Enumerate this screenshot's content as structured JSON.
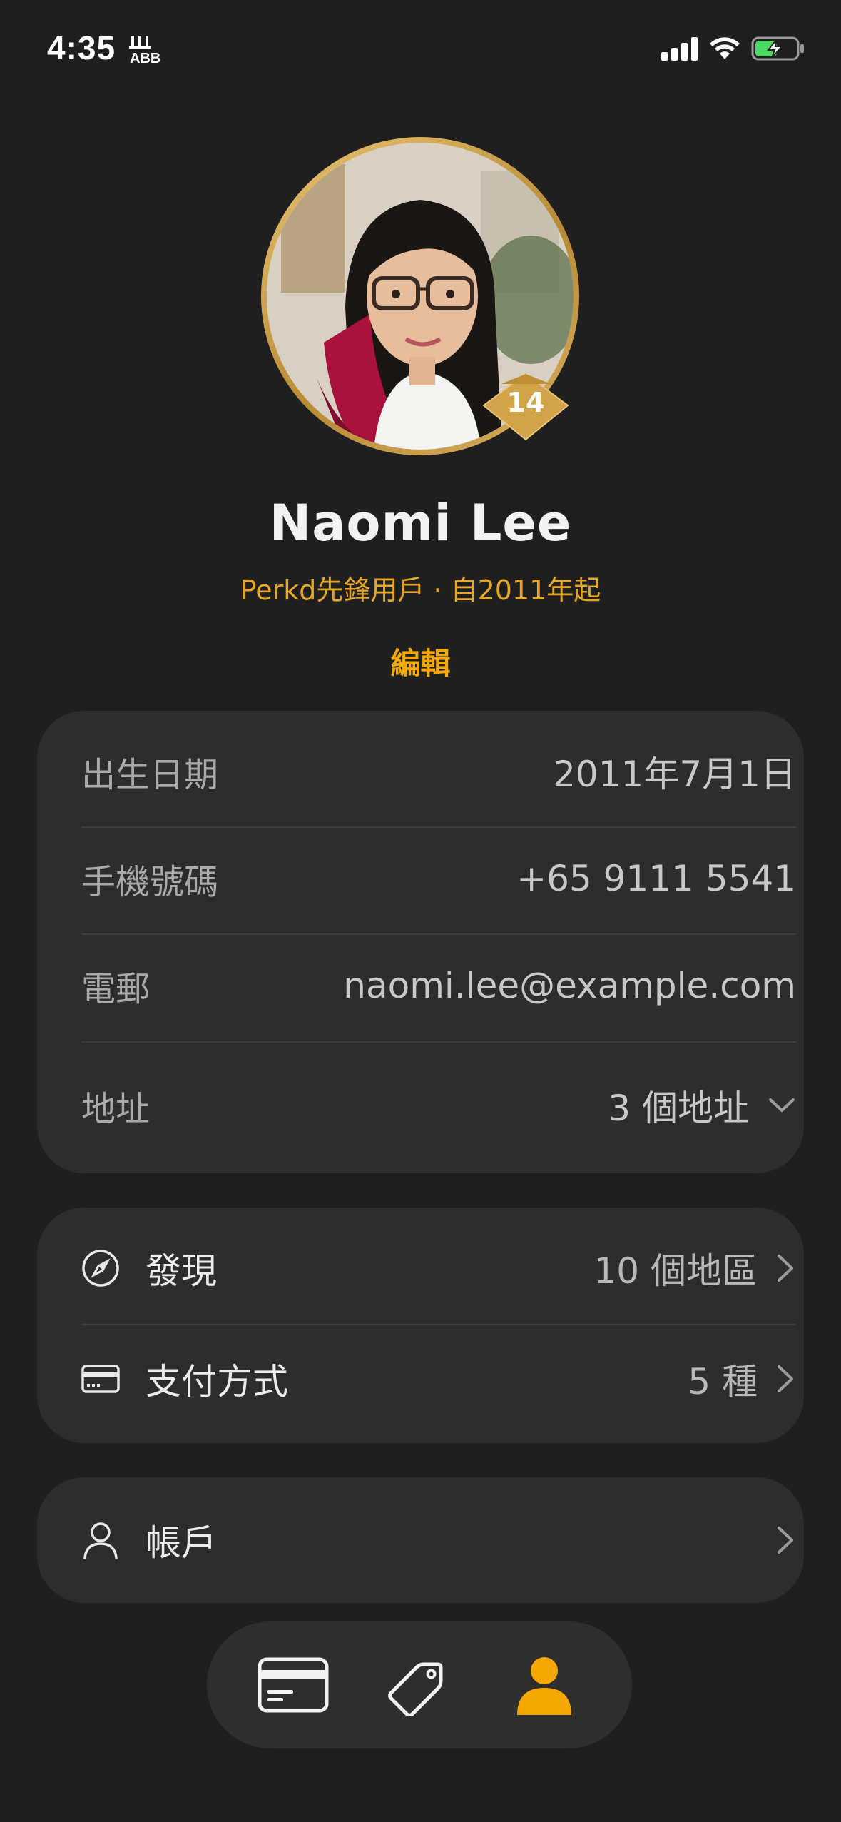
{
  "status_bar": {
    "time": "4:35",
    "app_icon": "abb-app-icon",
    "signal_icon": "cellular-signal-icon",
    "wifi_icon": "wifi-icon",
    "battery_icon": "battery-charging-icon"
  },
  "profile": {
    "level": "14",
    "name": "Naomi Lee",
    "subtitle": "Perkd先鋒用戶 · 自2011年起",
    "edit_label": "編輯"
  },
  "details": [
    {
      "label": "出生日期",
      "value": "2011年7月1日"
    },
    {
      "label": "手機號碼",
      "value": "+65 9111 5541"
    },
    {
      "label": "電郵",
      "value": "naomi.lee@example.com"
    },
    {
      "label": "地址",
      "value": "3 個地址",
      "icon": "chevron-down-icon"
    }
  ],
  "links": [
    {
      "label": "發現",
      "value": "10 個地區",
      "icon": "compass-icon"
    },
    {
      "label": "支付方式",
      "value": "5 種",
      "icon": "credit-card-icon"
    }
  ],
  "account": {
    "label": "帳戶",
    "icon": "person-icon"
  },
  "tab_bar": {
    "tabs": [
      {
        "icon": "card-icon",
        "active": false
      },
      {
        "icon": "tag-icon",
        "active": false
      },
      {
        "icon": "profile-icon",
        "active": true
      }
    ]
  },
  "colors": {
    "background": "#1f1f1f",
    "card": "#2d2d2d",
    "accent": "#f5a800",
    "gold": "#d4a84a"
  }
}
